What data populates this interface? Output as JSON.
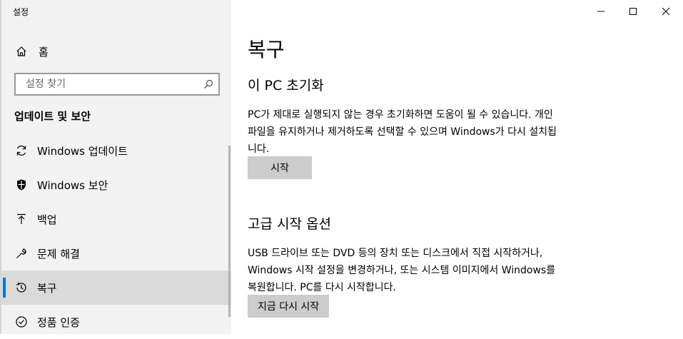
{
  "window": {
    "title": "설정",
    "minimize_icon": "minimize-icon",
    "maximize_icon": "maximize-icon",
    "close_icon": "close-icon"
  },
  "sidebar": {
    "home_label": "홈",
    "search_placeholder": "설정 찾기",
    "section_title": "업데이트 및 보안",
    "items": [
      {
        "label": "Windows 업데이트",
        "icon": "sync-icon"
      },
      {
        "label": "Windows 보안",
        "icon": "shield-icon"
      },
      {
        "label": "백업",
        "icon": "backup-arrow-icon"
      },
      {
        "label": "문제 해결",
        "icon": "wrench-icon"
      },
      {
        "label": "복구",
        "icon": "history-icon",
        "selected": true
      },
      {
        "label": "정품 인증",
        "icon": "check-circle-icon"
      }
    ]
  },
  "main": {
    "title": "복구",
    "reset": {
      "heading": "이 PC 초기화",
      "description": "PC가 제대로 실행되지 않는 경우 초기화하면 도움이 될 수 있습니다. 개인 파일을 유지하거나 제거하도록 선택할 수 있으며 Windows가 다시 설치됩니다.",
      "button_label": "시작"
    },
    "advanced": {
      "heading": "고급 시작 옵션",
      "description": "USB 드라이브 또는 DVD 등의 장치 또는 디스크에서 직접 시작하거나, Windows 시작 설정을 변경하거나, 또는 시스템 이미지에서 Windows를 복원합니다. PC를 다시 시작합니다.",
      "button_label": "지금 다시 시작"
    }
  },
  "colors": {
    "accent": "#0078d7",
    "sidebar_bg": "#f2f2f2",
    "selected_bg": "#dadada",
    "button_bg": "#cccccc"
  }
}
